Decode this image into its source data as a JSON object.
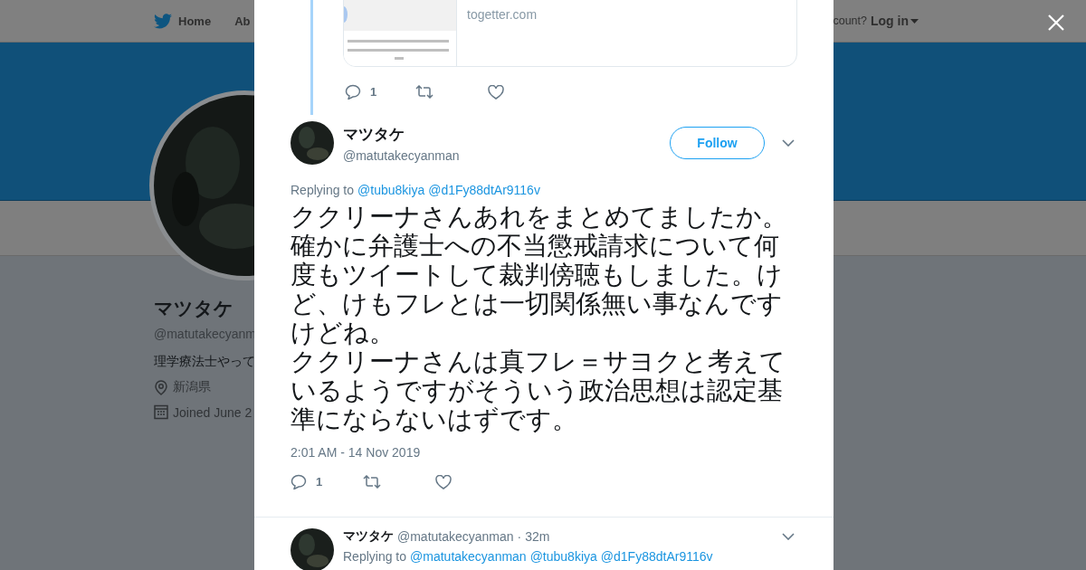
{
  "nav": {
    "items": [
      {
        "label": "Home",
        "kind": "home"
      },
      {
        "label": "Ab",
        "kind": "plain"
      }
    ],
    "account_prompt": "count?",
    "login": "Log in"
  },
  "profile": {
    "name": "マツタケ",
    "handle": "@matutakecyanm",
    "bio": "理学療法士やって",
    "location": "新潟県",
    "joined": "Joined June 2"
  },
  "parent_tweet": {
    "card": {
      "domain": "togetter.com"
    },
    "replies": "1"
  },
  "tweet": {
    "name": "マツタケ",
    "handle": "@matutakecyanman",
    "follow": "Follow",
    "replying_label": "Replying to",
    "mentions": [
      "@tubu8kiya",
      "@d1Fy88dtAr9116v"
    ],
    "paragraphs": [
      "ククリーナさんあれをまとめてましたか。",
      "確かに弁護士への不当懲戒請求について何度もツイートして裁判傍聴もしました。けど、けもフレとは一切関係無い事なんですけどね。",
      "ククリーナさんは真フレ＝サヨクと考えているようですがそういう政治思想は認定基準にならないはずです。"
    ],
    "timestamp": "2:01 AM - 14 Nov 2019",
    "replies": "1"
  },
  "reply": {
    "name": "マツタケ",
    "handle": "@matutakecyanman",
    "time": "· 32m",
    "replying_label": "Replying to",
    "mentions": [
      "@matutakecyanman",
      "@tubu8kiya",
      "@d1Fy88dtAr9116v"
    ]
  }
}
